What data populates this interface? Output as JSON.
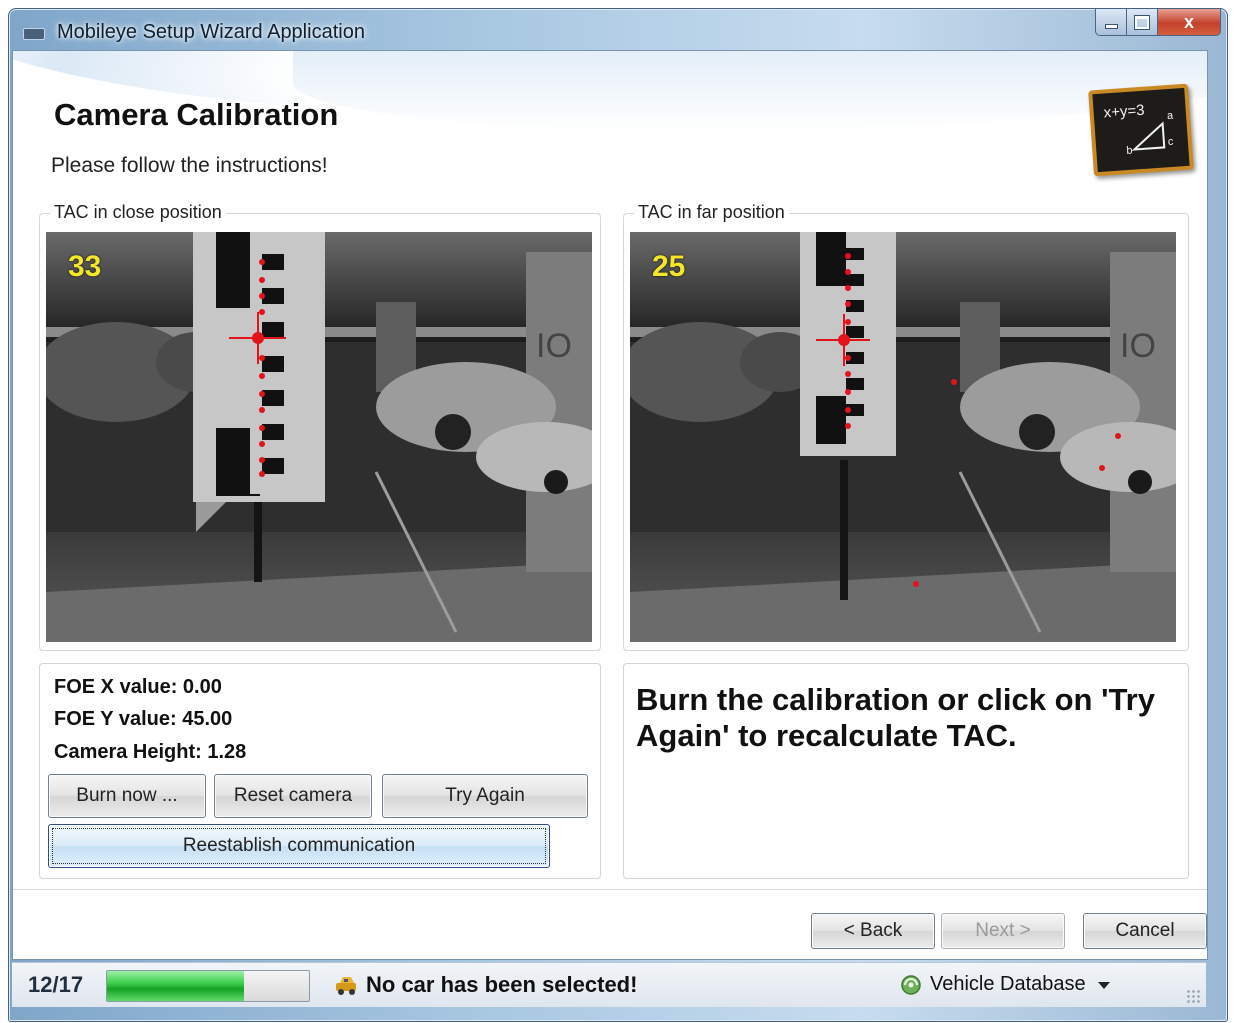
{
  "window": {
    "title": "Mobileye Setup Wizard Application",
    "close_glyph": "x"
  },
  "header": {
    "title": "Camera Calibration",
    "subtitle": "Please follow the instructions!",
    "icon": "chalkboard-formula-icon",
    "icon_text": "x+y=3"
  },
  "close_panel": {
    "label": "TAC in close position",
    "frame_number": "33"
  },
  "far_panel": {
    "label": "TAC in far position",
    "frame_number": "25"
  },
  "values": {
    "foe_x": "FOE X value: 0.00",
    "foe_y": "FOE Y value:  45.00",
    "camera_height": "Camera Height: 1.28"
  },
  "buttons": {
    "burn_now": "Burn now ...",
    "reset_camera": "Reset camera",
    "try_again": "Try Again",
    "reestablish": "Reestablish communication"
  },
  "instructions": "Burn the calibration or click on 'Try Again' to recalculate TAC.",
  "nav": {
    "back": "< Back",
    "next": "Next >",
    "cancel": "Cancel"
  },
  "status": {
    "step": "12/17",
    "progress_fraction": 0.68,
    "car_message": "No car has been selected!",
    "database_label": "Vehicle Database"
  },
  "colors": {
    "marker": "#e0141a",
    "frame_number": "#f4e62a",
    "progress": "#16a324"
  }
}
